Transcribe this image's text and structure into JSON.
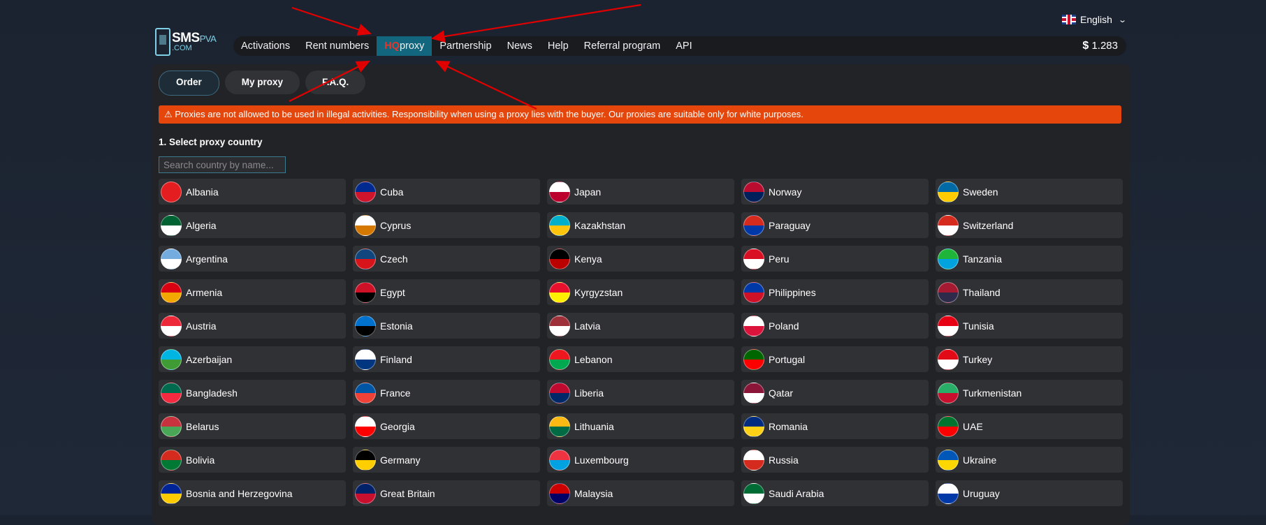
{
  "language": {
    "label": "English",
    "flag_icon": "uk-flag-icon"
  },
  "logo": {
    "main": "SMS",
    "accent": "PVA",
    "sub": ".COM"
  },
  "nav": {
    "items": [
      {
        "label": "Activations"
      },
      {
        "label": "Rent numbers"
      },
      {
        "label": "Partnership"
      },
      {
        "label": "News"
      },
      {
        "label": "Help"
      },
      {
        "label": "Referral program"
      },
      {
        "label": "API"
      }
    ],
    "active_prefix": "HQ",
    "active_suffix": "proxy",
    "balance_symbol": "$",
    "balance_value": "1.283"
  },
  "tabs": [
    {
      "label": "Order",
      "active": true
    },
    {
      "label": "My proxy",
      "active": false
    },
    {
      "label": "F.A.Q.",
      "active": false
    }
  ],
  "warning": "⚠ Proxies are not allowed to be used in illegal activities. Responsibility when using a proxy lies with the buyer. Our proxies are suitable only for white purposes.",
  "step_label": "1. Select proxy country",
  "search_placeholder": "Search country by name...",
  "countries": [
    {
      "name": "Albania",
      "c1": "#e41e20",
      "c2": "#e41e20"
    },
    {
      "name": "Cuba",
      "c1": "#002a8f",
      "c2": "#cf142b"
    },
    {
      "name": "Japan",
      "c1": "#ffffff",
      "c2": "#bc002d"
    },
    {
      "name": "Norway",
      "c1": "#ba0c2f",
      "c2": "#00205b"
    },
    {
      "name": "Sweden",
      "c1": "#006aa7",
      "c2": "#fecc00"
    },
    {
      "name": "Algeria",
      "c1": "#006233",
      "c2": "#ffffff"
    },
    {
      "name": "Cyprus",
      "c1": "#ffffff",
      "c2": "#d57800"
    },
    {
      "name": "Kazakhstan",
      "c1": "#00afca",
      "c2": "#fec50c"
    },
    {
      "name": "Paraguay",
      "c1": "#d52b1e",
      "c2": "#0038a8"
    },
    {
      "name": "Switzerland",
      "c1": "#d52b1e",
      "c2": "#ffffff"
    },
    {
      "name": "Argentina",
      "c1": "#74acdf",
      "c2": "#ffffff"
    },
    {
      "name": "Czech",
      "c1": "#11457e",
      "c2": "#d7141a"
    },
    {
      "name": "Kenya",
      "c1": "#000000",
      "c2": "#bb0000"
    },
    {
      "name": "Peru",
      "c1": "#d91023",
      "c2": "#ffffff"
    },
    {
      "name": "Tanzania",
      "c1": "#1eb53a",
      "c2": "#00a3dd"
    },
    {
      "name": "Armenia",
      "c1": "#d90012",
      "c2": "#f2a800"
    },
    {
      "name": "Egypt",
      "c1": "#ce1126",
      "c2": "#000000"
    },
    {
      "name": "Kyrgyzstan",
      "c1": "#e8112d",
      "c2": "#ffef00"
    },
    {
      "name": "Philippines",
      "c1": "#0038a8",
      "c2": "#ce1126"
    },
    {
      "name": "Thailand",
      "c1": "#a51931",
      "c2": "#2d2a4a"
    },
    {
      "name": "Austria",
      "c1": "#ed2939",
      "c2": "#ffffff"
    },
    {
      "name": "Estonia",
      "c1": "#0072ce",
      "c2": "#000000"
    },
    {
      "name": "Latvia",
      "c1": "#9e3039",
      "c2": "#ffffff"
    },
    {
      "name": "Poland",
      "c1": "#ffffff",
      "c2": "#dc143c"
    },
    {
      "name": "Tunisia",
      "c1": "#e70013",
      "c2": "#ffffff"
    },
    {
      "name": "Azerbaijan",
      "c1": "#00b5e2",
      "c2": "#3f9c35"
    },
    {
      "name": "Finland",
      "c1": "#ffffff",
      "c2": "#003580"
    },
    {
      "name": "Lebanon",
      "c1": "#ee161f",
      "c2": "#00a850"
    },
    {
      "name": "Portugal",
      "c1": "#006600",
      "c2": "#ff0000"
    },
    {
      "name": "Turkey",
      "c1": "#e30a17",
      "c2": "#ffffff"
    },
    {
      "name": "Bangladesh",
      "c1": "#006a4e",
      "c2": "#f42a41"
    },
    {
      "name": "France",
      "c1": "#0055a4",
      "c2": "#ef4135"
    },
    {
      "name": "Liberia",
      "c1": "#bf0a30",
      "c2": "#002868"
    },
    {
      "name": "Qatar",
      "c1": "#8a1538",
      "c2": "#ffffff"
    },
    {
      "name": "Turkmenistan",
      "c1": "#28ae66",
      "c2": "#c8102e"
    },
    {
      "name": "Belarus",
      "c1": "#c8313e",
      "c2": "#4aa657"
    },
    {
      "name": "Georgia",
      "c1": "#ffffff",
      "c2": "#ff0000"
    },
    {
      "name": "Lithuania",
      "c1": "#fdb913",
      "c2": "#006a44"
    },
    {
      "name": "Romania",
      "c1": "#002b7f",
      "c2": "#fcd116"
    },
    {
      "name": "UAE",
      "c1": "#00732f",
      "c2": "#ff0000"
    },
    {
      "name": "Bolivia",
      "c1": "#d52b1e",
      "c2": "#007934"
    },
    {
      "name": "Germany",
      "c1": "#000000",
      "c2": "#ffce00"
    },
    {
      "name": "Luxembourg",
      "c1": "#ef3340",
      "c2": "#00a2e1"
    },
    {
      "name": "Russia",
      "c1": "#ffffff",
      "c2": "#d52b1e"
    },
    {
      "name": "Ukraine",
      "c1": "#0057b7",
      "c2": "#ffd700"
    },
    {
      "name": "Bosnia and Herzegovina",
      "c1": "#002395",
      "c2": "#fecb00"
    },
    {
      "name": "Great Britain",
      "c1": "#012169",
      "c2": "#c8102e"
    },
    {
      "name": "Malaysia",
      "c1": "#cc0001",
      "c2": "#010066"
    },
    {
      "name": "Saudi Arabia",
      "c1": "#006c35",
      "c2": "#ffffff"
    },
    {
      "name": "Uruguay",
      "c1": "#ffffff",
      "c2": "#0038a8"
    }
  ],
  "colors": {
    "accent": "#12677e",
    "warning": "#e5460b",
    "arrow": "#e00000"
  }
}
